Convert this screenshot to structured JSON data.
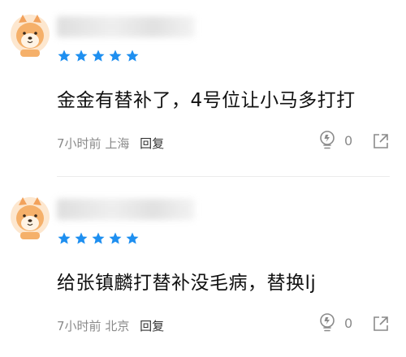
{
  "comments": [
    {
      "rating": 5,
      "text": "金金有替补了，4号位让小马多打打",
      "time": "7小时前",
      "location": "上海",
      "reply_label": "回复",
      "likes": "0"
    },
    {
      "rating": 5,
      "text": "给张镇麟打替补没毛病，替换lj",
      "time": "7小时前",
      "location": "北京",
      "reply_label": "回复",
      "likes": "0"
    }
  ],
  "icons": {
    "avatar": "shiba-dog-avatar",
    "star": "star-icon",
    "like": "lightbulb-like-icon",
    "share": "share-icon"
  },
  "colors": {
    "star": "#1e8ff0",
    "text": "#111111",
    "meta": "#8a8a8a"
  }
}
